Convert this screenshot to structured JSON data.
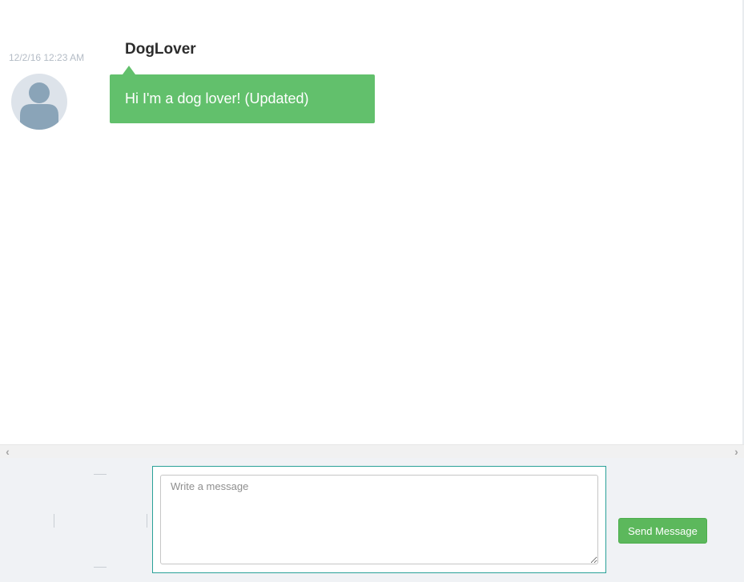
{
  "colors": {
    "bubble": "#62c06c",
    "send_button": "#5cb85c",
    "input_panel_border": "#2aa198",
    "compose_background": "#f0f2f5",
    "avatar_background": "#dde3ea",
    "avatar_figure": "#8aa4b8",
    "timestamp": "#b4bcc6"
  },
  "messages": [
    {
      "timestamp": "12/2/16 12:23 AM",
      "sender": "DogLover",
      "text": "Hi I'm a dog lover! (Updated)",
      "avatar_icon": "default-user-avatar-icon"
    }
  ],
  "scrollbar": {
    "left_arrow": "‹",
    "right_arrow": "›"
  },
  "compose": {
    "input_value": "",
    "input_placeholder": "Write a message",
    "send_label": "Send Message"
  }
}
